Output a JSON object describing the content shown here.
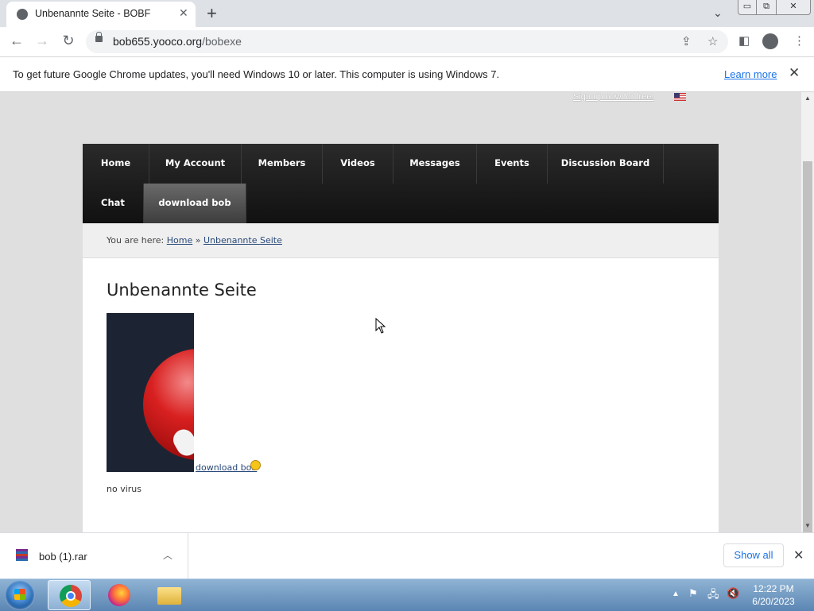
{
  "browser": {
    "tab_title": "Unbenannte Seite - BOBF",
    "tab_close": "✕",
    "new_tab": "+",
    "url_host": "bob655.yooco.org",
    "url_path": "/bobexe"
  },
  "infobar": {
    "message": "To get future Google Chrome updates, you'll need Windows 10 or later. This computer is using Windows 7.",
    "learn_more": "Learn more"
  },
  "site": {
    "signup": "Sign up now for free!",
    "nav": [
      "Home",
      "My Account",
      "Members",
      "Videos",
      "Messages",
      "Events",
      "Discussion Board",
      "Chat",
      "download bob"
    ],
    "breadcrumb_prefix": "You are here:",
    "breadcrumb_home": "Home",
    "breadcrumb_sep": "»",
    "breadcrumb_current": "Unbenannte Seite",
    "page_title": "Unbenannte Seite",
    "download_link": "download bob",
    "note": "no virus"
  },
  "downloads": {
    "file_name": "bob (1).rar",
    "show_all": "Show all"
  },
  "taskbar": {
    "time": "12:22 PM",
    "date": "6/20/2023"
  },
  "colors": {
    "link": "#1a73e8",
    "nav_bg": "#1a1a1a",
    "nav_active": "#555555"
  }
}
